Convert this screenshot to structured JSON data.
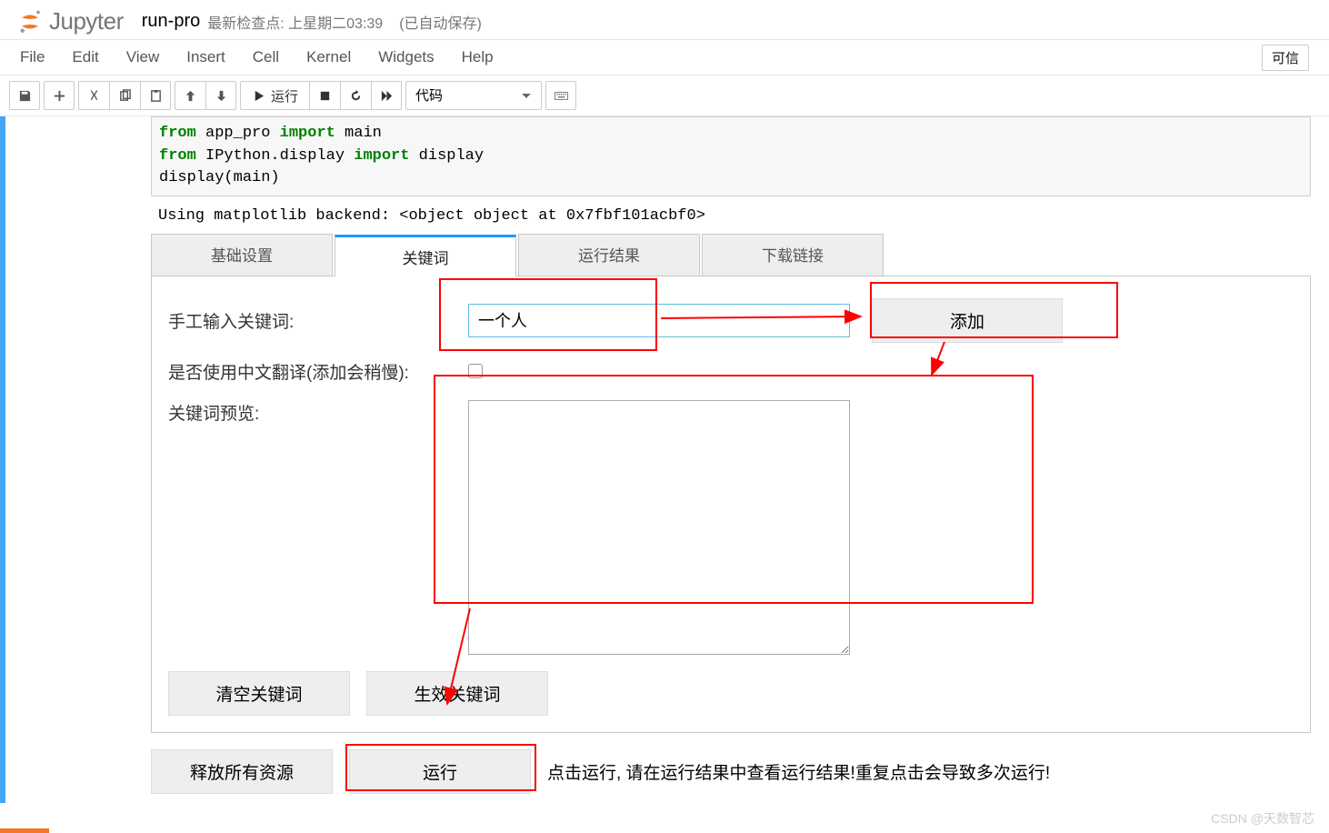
{
  "header": {
    "logo_text": "Jupyter",
    "notebook_name": "run-pro",
    "checkpoint": "最新检查点: 上星期二03:39",
    "autosave": "(已自动保存)"
  },
  "menubar": {
    "items": [
      "File",
      "Edit",
      "View",
      "Insert",
      "Cell",
      "Kernel",
      "Widgets",
      "Help"
    ],
    "trust": "可信"
  },
  "toolbar": {
    "run_label": "运行",
    "celltype": "代码"
  },
  "cell": {
    "code_line1_kw1": "from",
    "code_line1_txt1": " app_pro ",
    "code_line1_kw2": "import",
    "code_line1_txt2": " main",
    "code_line2_kw1": "from",
    "code_line2_txt1": " IPython.display ",
    "code_line2_kw2": "import",
    "code_line2_txt2": " display",
    "code_line3": "display(main)",
    "output_text": "Using matplotlib backend: <object object at 0x7fbf101acbf0>"
  },
  "widget": {
    "tabs": [
      "基础设置",
      "关键词",
      "运行结果",
      "下载链接"
    ],
    "form": {
      "label_input": "手工输入关键词:",
      "input_value": "一个人",
      "btn_add": "添加",
      "label_translate": "是否使用中文翻译(添加会稍慢):",
      "label_preview": "关键词预览:",
      "btn_clear": "清空关键词",
      "btn_apply": "生效关键词"
    },
    "run_row": {
      "btn_release": "释放所有资源",
      "btn_run": "运行",
      "run_hint": "点击运行, 请在运行结果中查看运行结果!重复点击会导致多次运行!"
    }
  },
  "watermark": "CSDN @天数智芯"
}
